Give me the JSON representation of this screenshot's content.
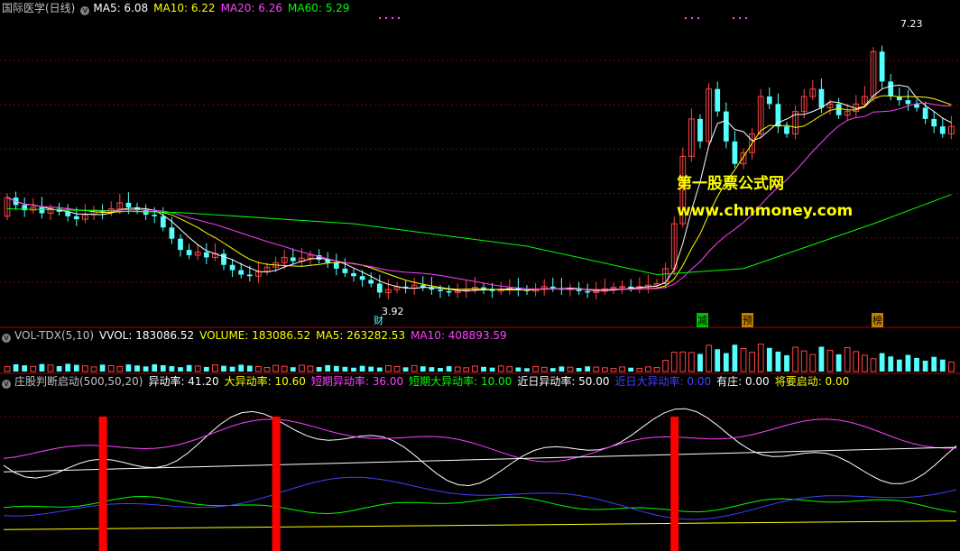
{
  "colors": {
    "background": "#000000",
    "grid": "#800000",
    "divider": "#b00000",
    "up": "#ff4444",
    "down": "#54ffff",
    "ma5": "#ffffff",
    "ma10": "#ffff00",
    "ma20": "#ff40ff",
    "ma60": "#00ff00",
    "alert": "#ff0000"
  },
  "price_panel": {
    "title": "国际医学(日线)",
    "ma5_label": "MA5: 6.08",
    "ma10_label": "MA10: 6.22",
    "ma20_label": "MA20: 6.26",
    "ma60_label": "MA60: 5.29",
    "high_label": "7.23",
    "low_label": "3.92",
    "markers": [
      "财",
      "减",
      "预",
      "榜"
    ],
    "watermark_line1": "第一股票公式网",
    "watermark_line2": "www.chnmoney.com"
  },
  "volume_panel": {
    "name": "VOL-TDX(5,10)",
    "vvol": "VVOL: 183086.52",
    "volume": "VOLUME: 183086.52",
    "ma5": "MA5: 263282.53",
    "ma10": "MA10: 408893.59"
  },
  "indicator_panel": {
    "name": "庄股判断启动(500,50,20)",
    "items": [
      {
        "label": "异动率: 41.20",
        "color": "#ffffff"
      },
      {
        "label": "大异动率: 10.60",
        "color": "#ffff00"
      },
      {
        "label": "短期异动率: 36.00",
        "color": "#ff40ff"
      },
      {
        "label": "短期大异动率: 10.00",
        "color": "#00ff00"
      },
      {
        "label": "近日异动率: 50.00",
        "color": "#ffffff"
      },
      {
        "label": "近日大异动率: 0.00",
        "color": "#4040ff"
      },
      {
        "label": "有庄: 0.00",
        "color": "#ffffff"
      },
      {
        "label": "将要启动: 0.00",
        "color": "#ffff00"
      }
    ]
  },
  "chart_data": [
    {
      "type": "candlestick",
      "title": "国际医学(日线)",
      "ylim": [
        3.6,
        7.6
      ],
      "num_bars": 110,
      "candles_open_close": [
        [
          5.0,
          5.25
        ],
        [
          5.25,
          5.15
        ],
        [
          5.15,
          5.08
        ],
        [
          5.08,
          5.12
        ],
        [
          5.12,
          5.04
        ],
        [
          5.04,
          5.1
        ],
        [
          5.1,
          5.06
        ],
        [
          5.06,
          5.0
        ],
        [
          5.0,
          4.96
        ],
        [
          4.96,
          5.02
        ],
        [
          5.02,
          5.08
        ],
        [
          5.08,
          5.05
        ],
        [
          5.05,
          5.1
        ],
        [
          5.1,
          5.18
        ],
        [
          5.18,
          5.12
        ],
        [
          5.12,
          5.08
        ],
        [
          5.08,
          5.02
        ],
        [
          5.02,
          5.0
        ],
        [
          5.0,
          4.85
        ],
        [
          4.85,
          4.7
        ],
        [
          4.7,
          4.55
        ],
        [
          4.55,
          4.48
        ],
        [
          4.48,
          4.52
        ],
        [
          4.52,
          4.45
        ],
        [
          4.45,
          4.5
        ],
        [
          4.5,
          4.35
        ],
        [
          4.35,
          4.28
        ],
        [
          4.28,
          4.22
        ],
        [
          4.22,
          4.2
        ],
        [
          4.2,
          4.26
        ],
        [
          4.26,
          4.32
        ],
        [
          4.32,
          4.38
        ],
        [
          4.38,
          4.45
        ],
        [
          4.45,
          4.4
        ],
        [
          4.4,
          4.44
        ],
        [
          4.44,
          4.48
        ],
        [
          4.48,
          4.42
        ],
        [
          4.42,
          4.38
        ],
        [
          4.38,
          4.3
        ],
        [
          4.3,
          4.24
        ],
        [
          4.24,
          4.2
        ],
        [
          4.2,
          4.15
        ],
        [
          4.15,
          4.1
        ],
        [
          4.1,
          3.98
        ],
        [
          3.98,
          4.02
        ],
        [
          4.02,
          4.06
        ],
        [
          4.06,
          4.04
        ],
        [
          4.04,
          4.08
        ],
        [
          4.08,
          4.05
        ],
        [
          4.05,
          4.02
        ],
        [
          4.02,
          4.0
        ],
        [
          4.0,
          3.98
        ],
        [
          3.98,
          4.0
        ],
        [
          4.0,
          4.02
        ],
        [
          4.02,
          4.05
        ],
        [
          4.05,
          4.03
        ],
        [
          4.03,
          4.0
        ],
        [
          4.0,
          4.02
        ],
        [
          4.02,
          4.04
        ],
        [
          4.04,
          4.02
        ],
        [
          4.02,
          4.0
        ],
        [
          4.0,
          4.03
        ],
        [
          4.03,
          4.06
        ],
        [
          4.06,
          4.04
        ],
        [
          4.04,
          4.02
        ],
        [
          4.02,
          4.04
        ],
        [
          4.04,
          4.0
        ],
        [
          4.0,
          3.98
        ],
        [
          3.98,
          4.0
        ],
        [
          4.0,
          4.03
        ],
        [
          4.03,
          4.05
        ],
        [
          4.05,
          4.06
        ],
        [
          4.06,
          4.04
        ],
        [
          4.04,
          4.06
        ],
        [
          4.06,
          4.08
        ],
        [
          4.08,
          4.1
        ],
        [
          4.1,
          4.3
        ],
        [
          4.3,
          4.9
        ],
        [
          4.9,
          5.8
        ],
        [
          5.8,
          6.3
        ],
        [
          6.3,
          6.0
        ],
        [
          6.0,
          6.7
        ],
        [
          6.7,
          6.4
        ],
        [
          6.4,
          6.0
        ],
        [
          6.0,
          5.7
        ],
        [
          5.7,
          5.85
        ],
        [
          5.85,
          6.1
        ],
        [
          6.1,
          6.6
        ],
        [
          6.6,
          6.5
        ],
        [
          6.5,
          6.2
        ],
        [
          6.2,
          6.1
        ],
        [
          6.1,
          6.4
        ],
        [
          6.4,
          6.6
        ],
        [
          6.6,
          6.7
        ],
        [
          6.7,
          6.45
        ],
        [
          6.45,
          6.5
        ],
        [
          6.5,
          6.35
        ],
        [
          6.35,
          6.4
        ],
        [
          6.4,
          6.5
        ],
        [
          6.5,
          6.6
        ],
        [
          6.6,
          7.2
        ],
        [
          7.2,
          6.8
        ],
        [
          6.8,
          6.6
        ],
        [
          6.6,
          6.55
        ],
        [
          6.55,
          6.5
        ],
        [
          6.5,
          6.45
        ],
        [
          6.45,
          6.3
        ],
        [
          6.3,
          6.2
        ],
        [
          6.2,
          6.1
        ],
        [
          6.1,
          6.2
        ]
      ],
      "high": 7.23,
      "low": 3.92,
      "ma60_points": [
        [
          0,
          5.1
        ],
        [
          20,
          5.05
        ],
        [
          40,
          4.9
        ],
        [
          60,
          4.6
        ],
        [
          75,
          4.22
        ],
        [
          85,
          4.3
        ],
        [
          100,
          4.9
        ],
        [
          109,
          5.29
        ]
      ]
    },
    {
      "type": "bar",
      "title": "VOL-TDX(5,10)",
      "num_bars": 110,
      "note": "relative volume, low before the rally then large during it",
      "volume_levels": [
        [
          0,
          0.25
        ],
        [
          75,
          0.15
        ],
        [
          76,
          0.5
        ],
        [
          80,
          0.9
        ],
        [
          95,
          0.8
        ],
        [
          109,
          0.4
        ]
      ]
    },
    {
      "type": "line",
      "title": "庄股判断启动(500,50,20)",
      "series": [
        {
          "name": "异动率",
          "end": 41.2
        },
        {
          "name": "大异动率",
          "end": 10.6
        },
        {
          "name": "短期异动率",
          "end": 36.0
        },
        {
          "name": "短期大异动率",
          "end": 10.0
        },
        {
          "name": "近日异动率",
          "end": 50.0
        },
        {
          "name": "近日大异动率",
          "end": 0.0
        }
      ],
      "signal_bars_at": [
        11,
        31,
        77
      ]
    }
  ]
}
